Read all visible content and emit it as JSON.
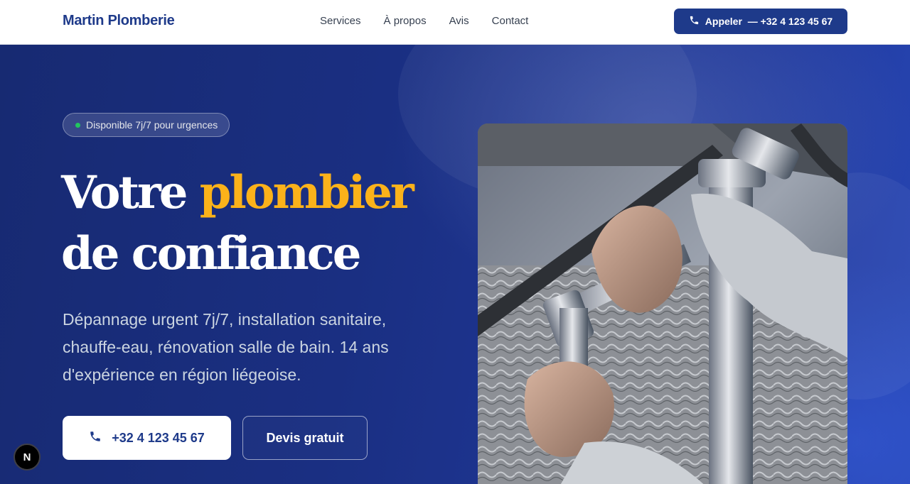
{
  "header": {
    "brand": "Martin Plomberie",
    "nav": [
      "Services",
      "À propos",
      "Avis",
      "Contact"
    ],
    "call_button": "Appeler  — +32 4 123 45 67"
  },
  "hero": {
    "badge": "Disponible 7j/7 pour urgences",
    "headline_part1": "Votre ",
    "headline_accent": "plombier",
    "headline_part2": " de confiance",
    "subtext": "Dépannage urgent 7j/7, installation sanitaire, chauffe-eau, rénovation salle de bain. 14 ans d'expérience en région liégeoise.",
    "phone_button": "+32 4 123 45 67",
    "quote_button": "Devis gratuit"
  },
  "overlay_badge": "N",
  "colors": {
    "primary": "#1e3a8a",
    "accent": "#fbb21a",
    "status_dot": "#22c55e"
  },
  "icons": [
    "phone-icon"
  ]
}
